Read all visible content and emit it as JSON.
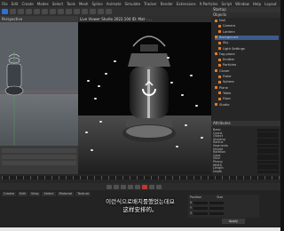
{
  "menu": [
    "File",
    "Edit",
    "Create",
    "Modes",
    "Select",
    "Tools",
    "Mesh",
    "Spline",
    "Animate",
    "Simulate",
    "Tracker",
    "Render",
    "Extensions",
    "X-Particles",
    "Script",
    "Window",
    "Help",
    "Layout"
  ],
  "right_header": "Startup",
  "left_view": {
    "title": "Perspective"
  },
  "viewport": {
    "title": "Live Viewer Studio 2022.104 ID: Mat - ..."
  },
  "objects_header": "Objects",
  "objects": [
    {
      "label": "Null"
    },
    {
      "label": "Camera"
    },
    {
      "label": "Lantern"
    },
    {
      "label": "Background"
    },
    {
      "label": "Sky"
    },
    {
      "label": "Light Settings"
    },
    {
      "label": "Fog plane"
    },
    {
      "label": "Emitter"
    },
    {
      "label": "Particles"
    },
    {
      "label": "Cloner"
    },
    {
      "label": "Flake"
    },
    {
      "label": "Sphere"
    },
    {
      "label": "Plane"
    },
    {
      "label": "Table"
    },
    {
      "label": "Floor"
    },
    {
      "label": "Studio"
    }
  ],
  "attributes_header": "Attributes",
  "attributes": [
    {
      "label": "Basic"
    },
    {
      "label": "Coord."
    },
    {
      "label": "Object"
    },
    {
      "label": "Shading"
    },
    {
      "label": "Radius"
    },
    {
      "label": "Segments"
    },
    {
      "label": "Height"
    },
    {
      "label": "Rotation"
    },
    {
      "label": "Caps"
    },
    {
      "label": "Slice"
    },
    {
      "label": "Phong"
    },
    {
      "label": "Width"
    },
    {
      "label": "Length"
    },
    {
      "label": "Depth"
    }
  ],
  "bottom_tabs": [
    "Create",
    "Edit",
    "View",
    "Select",
    "Material",
    "Texture"
  ],
  "coords": {
    "header_pos": "Position",
    "header_size": "Size",
    "x": "X",
    "y": "Y",
    "z": "Z",
    "apply": "Apply"
  },
  "subtitles": {
    "korean": "이런식으로배치를했었는데요",
    "chinese": "这样安排的。"
  }
}
